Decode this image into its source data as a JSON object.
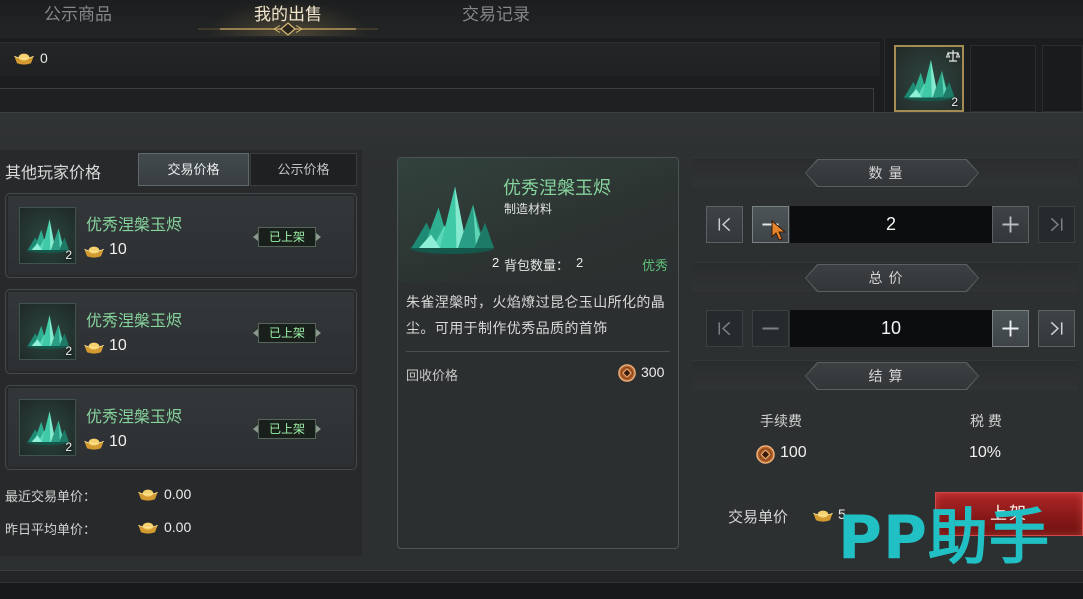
{
  "tabs": [
    {
      "label": "公示商品",
      "active": false
    },
    {
      "label": "我的出售",
      "active": true
    },
    {
      "label": "交易记录",
      "active": false
    }
  ],
  "currency": {
    "icon": "gold-ingot-icon",
    "amount": "0"
  },
  "inventory": {
    "selected_slot": {
      "icon": "jade-crystal-icon",
      "count": "2",
      "badge_icon": "scale-icon"
    }
  },
  "other_prices": {
    "title": "其他玩家价格",
    "toggle": [
      {
        "label": "交易价格",
        "active": true
      },
      {
        "label": "公示价格",
        "active": false
      }
    ],
    "listings": [
      {
        "icon": "jade-crystal-icon",
        "count": "2",
        "name": "优秀涅槃玉烬",
        "price_icon": "gold-ingot-icon",
        "price": "10",
        "status": "已上架"
      },
      {
        "icon": "jade-crystal-icon",
        "count": "2",
        "name": "优秀涅槃玉烬",
        "price_icon": "gold-ingot-icon",
        "price": "10",
        "status": "已上架"
      },
      {
        "icon": "jade-crystal-icon",
        "count": "2",
        "name": "优秀涅槃玉烬",
        "price_icon": "gold-ingot-icon",
        "price": "10",
        "status": "已上架"
      }
    ],
    "recent_label": "最近交易单价：",
    "recent_value": "0.00",
    "yesterday_label": "昨日平均单价：",
    "yesterday_value": "0.00"
  },
  "item_detail": {
    "icon": "jade-crystal-icon",
    "icon_count": "2",
    "name": "优秀涅槃玉烬",
    "category": "制造材料",
    "bag_label": "背包数量：",
    "bag_count": "2",
    "quality": "优秀",
    "description": "朱雀涅槃时，火焰燎过昆仑玉山所化的晶尘。可用于制作优秀品质的首饰",
    "recycle_label": "回收价格",
    "recycle_icon": "copper-coin-icon",
    "recycle_price": "300"
  },
  "sell_form": {
    "quantity_header": "数量",
    "quantity": "2",
    "total_header": "总价",
    "total": "10",
    "settle_header": "结算",
    "fee_label": "手续费",
    "fee_icon": "copper-coin-icon",
    "fee": "100",
    "tax_label": "税 费",
    "tax": "10%",
    "unit_price_label": "交易单价",
    "unit_price_icon": "gold-ingot-icon",
    "unit_price": "5",
    "submit_label": "上架"
  },
  "watermark": "PP助手",
  "colors": {
    "active_tab": "#f2e7cd",
    "item_name": "#86d39c",
    "quality_good": "#5fc078",
    "status_listed": "#9cf0a6",
    "submit_red": "#9e1e1e",
    "selected_slot_border": "#a58c52",
    "watermark": "#20c0c4"
  }
}
